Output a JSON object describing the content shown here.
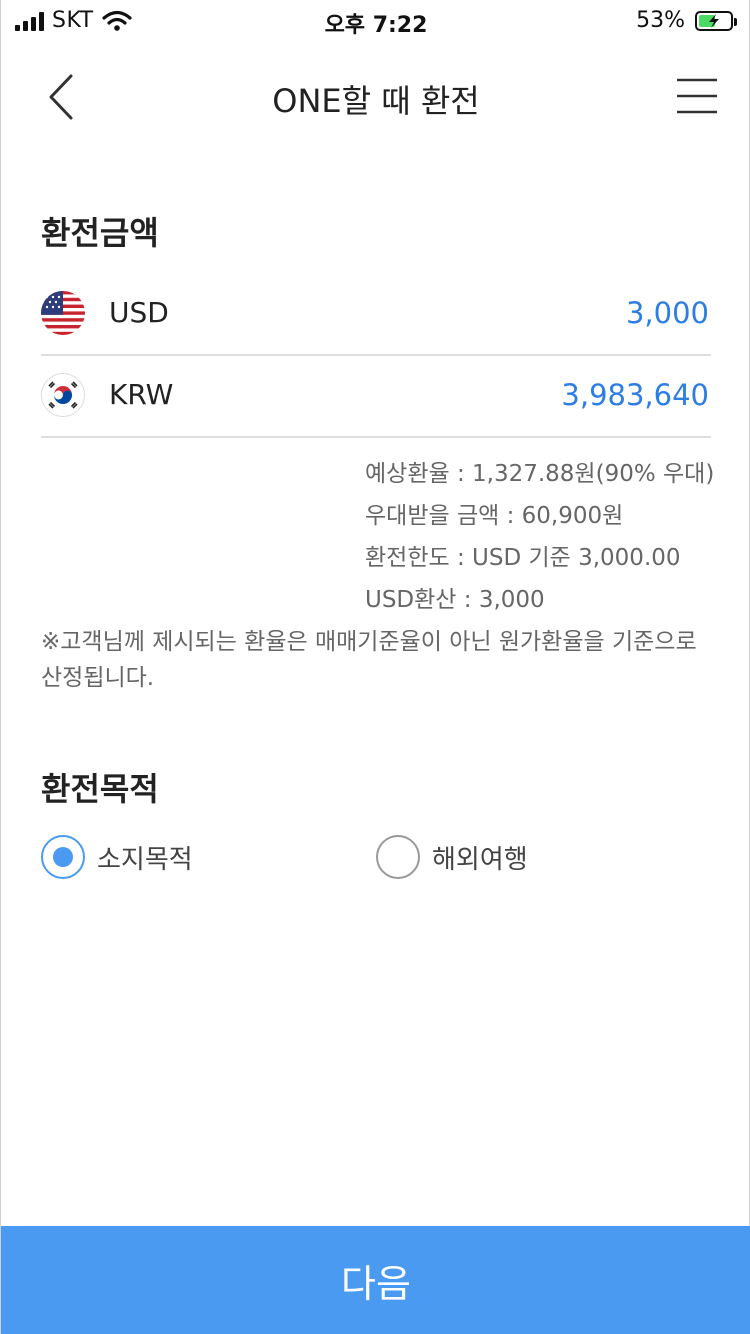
{
  "statusbar": {
    "carrier": "SKT",
    "time": "오후 7:22",
    "battery_text": "53%",
    "battery_level": 0.53
  },
  "header": {
    "title": "ONE할 때 환전"
  },
  "exchange_amount": {
    "title": "환전금액",
    "rows": [
      {
        "flag": "us-flag-icon",
        "code": "USD",
        "amount": "3,000"
      },
      {
        "flag": "kr-flag-icon",
        "code": "KRW",
        "amount": "3,983,640"
      }
    ]
  },
  "info": {
    "lines": [
      "예상환율 : 1,327.88원(90% 우대)",
      "우대받을 금액 : 60,900원",
      "환전한도 : USD 기준 3,000.00",
      "USD환산 : 3,000"
    ],
    "notice": "※고객님께 제시되는 환율은 매매기준율이 아닌 원가환율을 기준으로 산정됩니다."
  },
  "purpose": {
    "title": "환전목적",
    "options": [
      {
        "label": "소지목적",
        "checked": true
      },
      {
        "label": "해외여행",
        "checked": false
      }
    ]
  },
  "footer": {
    "next_label": "다음"
  },
  "colors": {
    "accent": "#4a9af2",
    "amount": "#2d7ee2",
    "battery_fill": "#4cd964"
  }
}
